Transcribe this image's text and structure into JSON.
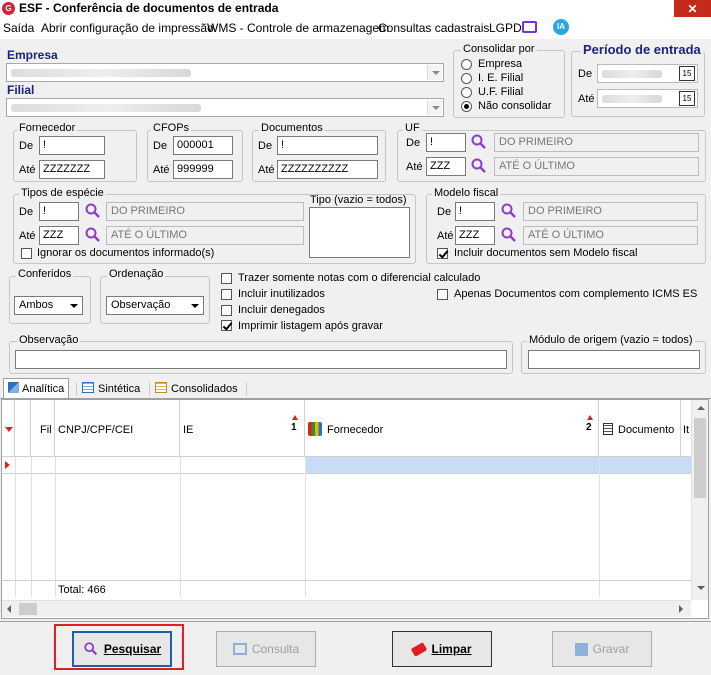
{
  "window": {
    "title": "ESF - Conferência de documentos de entrada",
    "logo_text": "G",
    "close": "✕"
  },
  "menu": {
    "items": [
      {
        "label": "Saída"
      },
      {
        "label": "Abrir configuração de impressão"
      },
      {
        "label": "WMS - Controle de armazenagem"
      },
      {
        "label": "Consultas cadastrais"
      },
      {
        "label": "LGPD"
      }
    ],
    "ia_label": "IA"
  },
  "empresa": {
    "label": "Empresa"
  },
  "filial": {
    "label": "Filial"
  },
  "consolidar": {
    "title": "Consolidar por",
    "options": [
      "Empresa",
      "I. E. Filial",
      "U.F. Filial",
      "Não consolidar"
    ],
    "selected": "Não consolidar"
  },
  "periodo": {
    "title": "Período de entrada",
    "de_label": "De",
    "ate_label": "Até",
    "cal_icon": "15"
  },
  "fornecedor": {
    "title": "Fornecedor",
    "de_label": "De",
    "ate_label": "Até",
    "de": "!",
    "ate": "ZZZZZZZ"
  },
  "cfops": {
    "title": "CFOPs",
    "de_label": "De",
    "ate_label": "Até",
    "de": "000001",
    "ate": "999999"
  },
  "documentos": {
    "title": "Documentos",
    "de_label": "De",
    "ate_label": "Até",
    "de": "!",
    "ate": "ZZZZZZZZZZ"
  },
  "uf": {
    "title": "UF",
    "de_label": "De",
    "ate_label": "Até",
    "de": "!",
    "ate": "ZZZ",
    "de_desc": "DO PRIMEIRO",
    "ate_desc": "ATÉ O ÚLTIMO"
  },
  "tipos_especie": {
    "title": "Tipos de espécie",
    "de_label": "De",
    "ate_label": "Até",
    "de": "!",
    "ate": "ZZZ",
    "de_desc": "DO PRIMEIRO",
    "ate_desc": "ATÉ O ÚLTIMO",
    "ignorar_label": "Ignorar os documentos informado(s)",
    "tipo_label": "Tipo (vazio = todos)"
  },
  "modelo_fiscal": {
    "title": "Modelo fiscal",
    "de_label": "De",
    "ate_label": "Até",
    "de": "!",
    "ate": "ZZZ",
    "de_desc": "DO PRIMEIRO",
    "ate_desc": "ATÉ O ÚLTIMO",
    "incluir_label": "Incluir documentos sem Modelo fiscal"
  },
  "conferidos": {
    "title": "Conferidos",
    "value": "Ambos"
  },
  "ordenacao": {
    "title": "Ordenação",
    "value": "Observação"
  },
  "options": {
    "trazer": "Trazer somente notas com o diferencial calculado",
    "inutilizados": "Incluir inutilizados",
    "denegados": "Incluir denegados",
    "imprimir": "Imprimir listagem após gravar",
    "icms": "Apenas Documentos com complemento ICMS ES"
  },
  "observacao": {
    "title": "Observação"
  },
  "modulo": {
    "title": "Módulo de origem (vazio = todos)"
  },
  "tabs": [
    {
      "label": "Analítica"
    },
    {
      "label": "Sintética"
    },
    {
      "label": "Consolidados"
    }
  ],
  "grid": {
    "columns": [
      {
        "label": "Fil"
      },
      {
        "label": "CNPJ/CPF/CEI"
      },
      {
        "label": "IE",
        "sort": "1"
      },
      {
        "label": "Fornecedor",
        "sort": "2"
      },
      {
        "label": "Documento"
      },
      {
        "label": "It"
      }
    ],
    "footer_total": "Total: 466"
  },
  "buttons": {
    "pesquisar": "Pesquisar",
    "consulta": "Consulta",
    "limpar": "Limpar",
    "gravar": "Gravar"
  },
  "colors": {
    "accent": "#1a237e",
    "highlight": "#e02020",
    "selected_row": "#c7dcf5"
  }
}
